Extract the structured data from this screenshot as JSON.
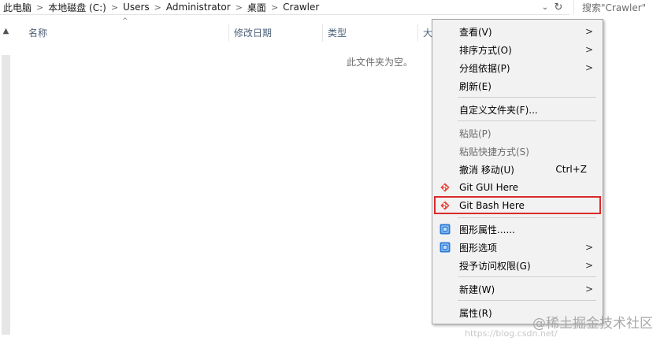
{
  "address": {
    "crumbs": [
      "此电脑",
      "本地磁盘 (C:)",
      "Users",
      "Administrator",
      "桌面",
      "Crawler"
    ],
    "separator": ">",
    "dropdown_glyph": "⌄",
    "refresh_glyph": "↻"
  },
  "search": {
    "placeholder": "搜索\"Crawler\""
  },
  "columns": {
    "name": "名称",
    "modified": "修改日期",
    "type": "类型",
    "size": "大"
  },
  "sort_glyph": "^",
  "scroll_up_glyph": "▲",
  "empty_message": "此文件夹为空。",
  "menu": {
    "view": "查看(V)",
    "sort_by": "排序方式(O)",
    "group_by": "分组依据(P)",
    "refresh": "刷新(E)",
    "customize_folder": "自定义文件夹(F)...",
    "paste": "粘贴(P)",
    "paste_shortcut": "粘贴快捷方式(S)",
    "undo_move": "撤消 移动(U)",
    "undo_shortcut": "Ctrl+Z",
    "git_gui": "Git GUI Here",
    "git_bash": "Git Bash Here",
    "graphics_properties": "图形属性......",
    "graphics_options": "图形选项",
    "give_access": "授予访问权限(G)",
    "new": "新建(W)",
    "properties": "属性(R)",
    "submenu_arrow": ">"
  },
  "watermark": "@稀土掘金技术社区",
  "watermark_url": "https://blog.csdn.net/",
  "colors": {
    "highlight": "#d92a2a",
    "menu_bg": "#f2f2f2",
    "git_icon": "#e8483b",
    "intel_icon": "#2b78d6"
  }
}
